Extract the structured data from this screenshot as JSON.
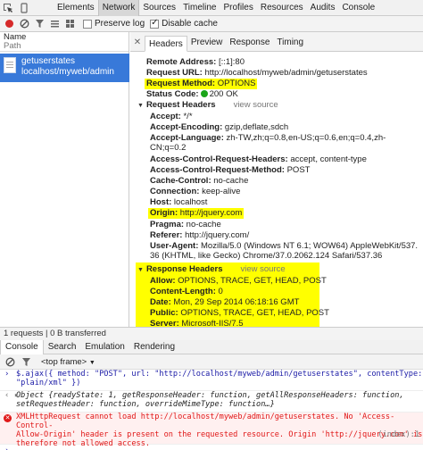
{
  "top_tabs": [
    "Elements",
    "Network",
    "Sources",
    "Timeline",
    "Profiles",
    "Resources",
    "Audits",
    "Console"
  ],
  "net_toolbar": {
    "preserve_log": "Preserve log",
    "disable_cache": "Disable cache"
  },
  "left": {
    "name_header": "Name",
    "path_header": "Path",
    "request_name": "getuserstates",
    "request_path": "localhost/myweb/admin"
  },
  "detail_tabs": [
    "Headers",
    "Preview",
    "Response",
    "Timing"
  ],
  "general": {
    "remote_address_k": "Remote Address:",
    "remote_address_v": "[::1]:80",
    "request_url_k": "Request URL:",
    "request_url_v": "http://localhost/myweb/admin/getuserstates",
    "request_method_k": "Request Method:",
    "request_method_v": "OPTIONS",
    "status_code_k": "Status Code:",
    "status_code_v": "200 OK"
  },
  "request_headers": {
    "title": "Request Headers",
    "view_source": "view source",
    "accept_k": "Accept:",
    "accept_v": "*/*",
    "encoding_k": "Accept-Encoding:",
    "encoding_v": "gzip,deflate,sdch",
    "language_k": "Accept-Language:",
    "language_v1": "zh-TW,zh;q=0.8,en-US;q=0.6,en;q=0.4,zh-",
    "language_v2": "CN;q=0.2",
    "acr_headers_k": "Access-Control-Request-Headers:",
    "acr_headers_v": "accept, content-type",
    "acr_method_k": "Access-Control-Request-Method:",
    "acr_method_v": "POST",
    "cache_k": "Cache-Control:",
    "cache_v": "no-cache",
    "connection_k": "Connection:",
    "connection_v": "keep-alive",
    "host_k": "Host:",
    "host_v": "localhost",
    "origin_k": "Origin:",
    "origin_v": "http://jquery.com",
    "pragma_k": "Pragma:",
    "pragma_v": "no-cache",
    "referer_k": "Referer:",
    "referer_v": "http://jquery.com/",
    "ua_k": "User-Agent:",
    "ua_v1": "Mozilla/5.0 (Windows NT 6.1; WOW64) AppleWebKit/537.",
    "ua_v2": "36 (KHTML, like Gecko) Chrome/37.0.2062.124 Safari/537.36"
  },
  "response_headers": {
    "title": "Response Headers",
    "view_source": "view source",
    "allow_k": "Allow:",
    "allow_v": "OPTIONS, TRACE, GET, HEAD, POST",
    "length_k": "Content-Length:",
    "length_v": "0",
    "date_k": "Date:",
    "date_v": "Mon, 29 Sep 2014 06:18:16 GMT",
    "public_k": "Public:",
    "public_v": "OPTIONS, TRACE, GET, HEAD, POST",
    "server_k": "Server:",
    "server_v": "Microsoft-IIS/7.5"
  },
  "status_bar": "1 requests | 0 B transferred",
  "drawer_tabs": [
    "Console",
    "Search",
    "Emulation",
    "Rendering"
  ],
  "frame_select": "<top frame>",
  "console": {
    "cmd_1": "$.ajax({ method: \"POST\", url: \"http://localhost/myweb/admin/getuserstates\", contentType:",
    "cmd_2": "\"plain/xml\" })",
    "obj_1": "Object {readyState: 1, getResponseHeader: function, getAllResponseHeaders: function,",
    "obj_2": "setRequestHeader: function, overrideMimeType: function…}",
    "err_1": "XMLHttpRequest cannot load http://localhost/myweb/admin/getuserstates. No 'Access-Control-",
    "err_2": "Allow-Origin' header is present on the requested resource. Origin 'http://jquery.com' is",
    "err_3": "therefore not allowed access.",
    "err_src": "(index):1"
  },
  "colors": {
    "selected_row": "#3879d9",
    "highlight": "#ffff00",
    "error": "#e01818",
    "status_ok": "#1aa51a"
  }
}
